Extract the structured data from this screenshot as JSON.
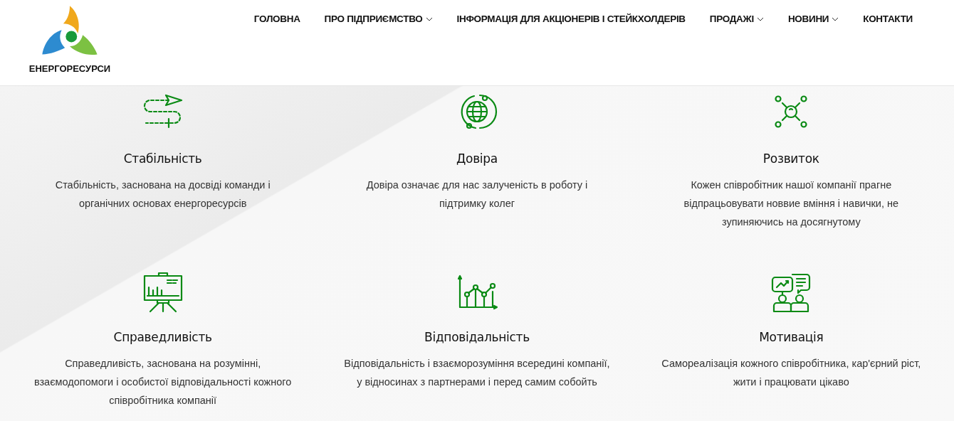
{
  "logo": {
    "name": "ЕНЕРГОРЕСУРСИ"
  },
  "nav": [
    {
      "label": "ГОЛОВНА",
      "dropdown": false
    },
    {
      "label": "ПРО ПІДПРИЄМСТВО",
      "dropdown": true
    },
    {
      "label": "ІНФОРМАЦІЯ ДЛЯ АКЦІОНЕРІВ І СТЕЙКХОЛДЕРІВ",
      "dropdown": false
    },
    {
      "label": "ПРОДАЖІ",
      "dropdown": true
    },
    {
      "label": "НОВИНИ",
      "dropdown": true
    },
    {
      "label": "КОНТАКТИ",
      "dropdown": false
    }
  ],
  "values": [
    {
      "title": "Стабільність",
      "text": "Стабільність, заснована на досвіді команди і органічних основах енергоресурсів"
    },
    {
      "title": "Довіра",
      "text": "Довіра означає для нас залученість в роботу і підтримку колег"
    },
    {
      "title": "Розвиток",
      "text": "Кожен співробітник нашої компанії прагне відпрацьовувати новвие вміння і навички, не зупиняючись на досягнутому"
    },
    {
      "title": "Справедливість",
      "text": "Справедливість, заснована на розумінні, взаємодопомоги і особистої відповідальності кожного співробітника компанії"
    },
    {
      "title": "Відповідальність",
      "text": "Відповідальність і взаєморозуміння всередині компанії, у відносинах з партнерами і перед самим собойть"
    },
    {
      "title": "Мотивація",
      "text": "Самореалізація кожного співробітника, кар'єрний ріст, жити і працювати цікаво"
    }
  ]
}
